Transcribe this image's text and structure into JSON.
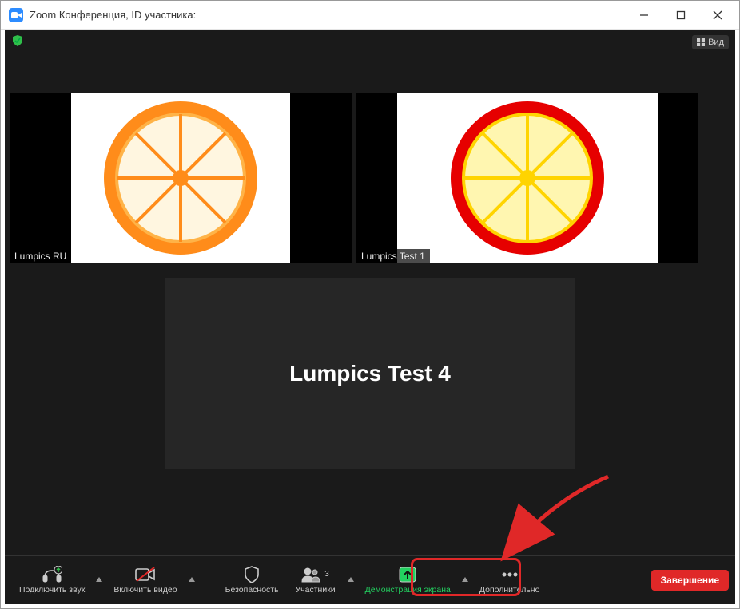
{
  "titlebar": {
    "title": "Zoom Конференция, ID участника:"
  },
  "topbar": {
    "view_label": "Вид"
  },
  "participants": [
    {
      "name": "Lumpics RU",
      "active": true,
      "avatar": "orange"
    },
    {
      "name": "Lumpics Test 1",
      "active": false,
      "avatar": "lemon"
    }
  ],
  "main_participant": {
    "name": "Lumpics Test 4"
  },
  "toolbar": {
    "audio": "Подключить звук",
    "video": "Включить видео",
    "security": "Безопасность",
    "participants": "Участники",
    "participants_count": "3",
    "share": "Демонстрация экрана",
    "more": "Дополнительно",
    "end": "Завершение"
  }
}
